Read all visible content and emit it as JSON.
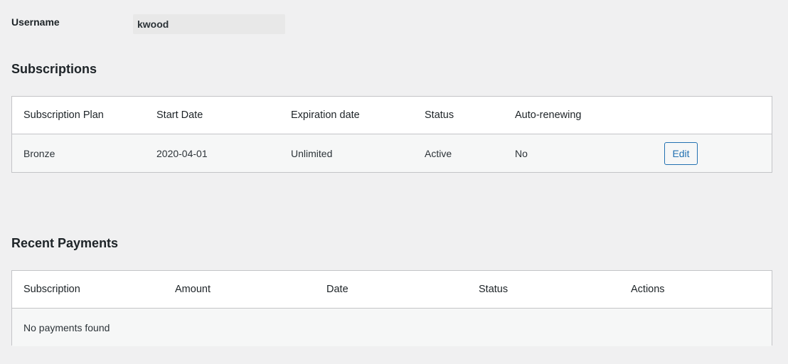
{
  "username": {
    "label": "Username",
    "value": "kwood"
  },
  "subscriptions": {
    "title": "Subscriptions",
    "columns": [
      "Subscription Plan",
      "Start Date",
      "Expiration date",
      "Status",
      "Auto-renewing"
    ],
    "rows": [
      {
        "plan": "Bronze",
        "start_date": "2020-04-01",
        "expiration_date": "Unlimited",
        "status": "Active",
        "auto_renewing": "No",
        "action_label": "Edit"
      }
    ]
  },
  "payments": {
    "title": "Recent Payments",
    "columns": [
      "Subscription",
      "Amount",
      "Date",
      "Status",
      "Actions"
    ],
    "empty_message": "No payments found"
  },
  "colors": {
    "background": "#f0f0f1",
    "accent": "#2271b1",
    "border": "#c3c4c7"
  }
}
